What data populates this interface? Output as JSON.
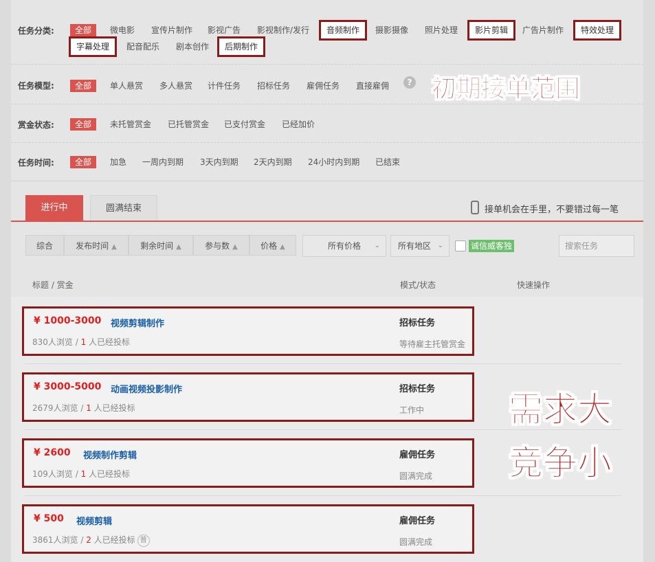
{
  "filters": {
    "category": {
      "label": "任务分类:",
      "items_row1": [
        "全部",
        "微电影",
        "宣传片制作",
        "影视广告",
        "影视制作/发行",
        "音频制作",
        "摄影摄像",
        "照片处理",
        "影片剪辑",
        "广告片制作",
        "特效处理"
      ],
      "items_row2": [
        "字幕处理",
        "配音配乐",
        "剧本创作",
        "后期制作"
      ]
    },
    "model": {
      "label": "任务模型:",
      "items": [
        "全部",
        "单人悬赏",
        "多人悬赏",
        "计件任务",
        "招标任务",
        "雇佣任务",
        "直接雇佣"
      ],
      "help": "?"
    },
    "reward_status": {
      "label": "赏金状态:",
      "items": [
        "全部",
        "未托管赏金",
        "已托管赏金",
        "已支付赏金",
        "已经加价"
      ]
    },
    "time": {
      "label": "任务时间:",
      "items": [
        "全部",
        "加急",
        "一周内到期",
        "3天内到期",
        "2天内到期",
        "24小时内到期",
        "已结束"
      ]
    }
  },
  "overlays": {
    "scope_text": "初期接单范围",
    "demand_line1": "需求大",
    "demand_line2": "竞争小"
  },
  "tabs": {
    "active": "进行中",
    "idle": "圆满结束"
  },
  "phone_note": "接单机会在手里，不要错过每一笔",
  "sortbar": {
    "items": [
      "综合",
      "发布时间",
      "剩余时间",
      "参与数",
      "价格"
    ],
    "arrow": "▲",
    "price_dropdown": "所有价格",
    "region_dropdown": "所有地区",
    "chevron": "⌄",
    "cert_badge": "诚信威客独",
    "search_placeholder": "搜索任务"
  },
  "columns": {
    "title": "标题 / 赏金",
    "mode": "模式/状态",
    "quick": "快速操作"
  },
  "tasks": [
    {
      "price": "¥ 1000-3000",
      "title": "视频剪辑制作",
      "views": "830人浏览 / ",
      "bids": "1",
      "bids_suffix": " 人已经投标",
      "mode": "招标任务",
      "status": "等待雇主托管赏金"
    },
    {
      "price": "¥ 3000-5000",
      "title": "动画视频投影制作",
      "views": "2679人浏览 / ",
      "bids": "1",
      "bids_suffix": " 人已经投标",
      "mode": "招标任务",
      "status": "工作中"
    },
    {
      "price": "¥ 2600",
      "title": "视频制作剪辑",
      "views": "109人浏览 / ",
      "bids": "1",
      "bids_suffix": " 人已经投标",
      "mode": "雇佣任务",
      "status": "圆满完成"
    },
    {
      "price": "¥ 500",
      "title": "视频剪辑",
      "views": "3861人浏览 / ",
      "bids": "2",
      "bids_suffix": " 人已经投标",
      "mode": "雇佣任务",
      "status": "圆满完成",
      "badge": "普"
    }
  ],
  "colors": {
    "accent": "#d9534f",
    "box_border": "#8b1a1a",
    "price": "#e02020",
    "link": "#1a5fa8"
  }
}
